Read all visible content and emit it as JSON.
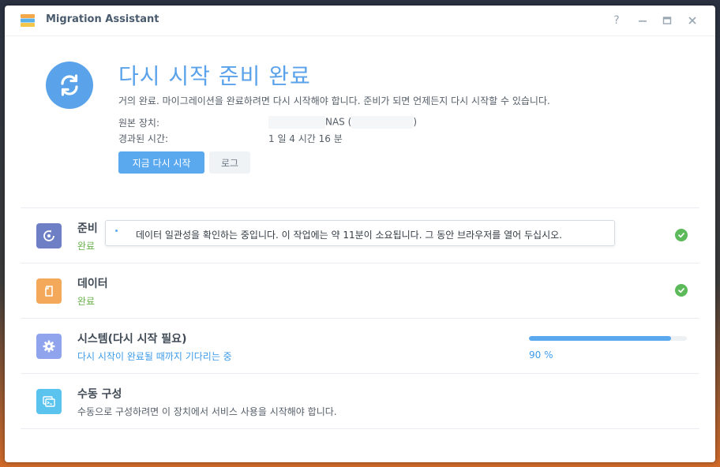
{
  "window": {
    "title": "Migration Assistant",
    "controls": {
      "help": "?",
      "minimize": "minimize-icon",
      "maximize": "maximize-icon",
      "close": "close-icon"
    }
  },
  "header": {
    "icon": "refresh-icon",
    "title": "다시 시작 준비 완료",
    "subtitle": "거의 완료. 마이그레이션을 완료하려면 다시 시작해야 합니다. 준비가 되면 언제든지 다시 시작할 수 있습니다.",
    "source_label": "원본 장치:",
    "source_value_suffix": "NAS (",
    "source_value_close": ")",
    "elapsed_label": "경과된 시간:",
    "elapsed_value": "1 일 4 시간 16 분",
    "restart_button": "지금 다시 시작",
    "log_button": "로그"
  },
  "steps": [
    {
      "icon": "prepare-icon",
      "title": "준비",
      "status": "완료",
      "state": "done"
    },
    {
      "icon": "data-icon",
      "title": "데이터",
      "status": "완료",
      "state": "done"
    },
    {
      "icon": "gear-icon",
      "title": "시스템(다시 시작 필요)",
      "status": "다시 시작이 완료될 때까지 기다리는 중",
      "state": "progress",
      "progress": 90,
      "progress_label": "90 %"
    },
    {
      "icon": "terminal-icon",
      "title": "수동 구성",
      "status": "수동으로 구성하려면 이 장치에서 서비스 사용을 시작해야 합니다.",
      "state": "info"
    }
  ],
  "tooltip": {
    "text": "데이터 일관성을 확인하는 중입니다. 이 작업에는 약 11분이 소요됩니다. 그 동안 브라우저를 열어 두십시오."
  },
  "colors": {
    "accent": "#5aa8ee",
    "success": "#5cba5a",
    "step1": "#6e7fc6",
    "step2": "#f4a85a",
    "step3": "#8fa4ec",
    "step4": "#5ac3ee"
  }
}
